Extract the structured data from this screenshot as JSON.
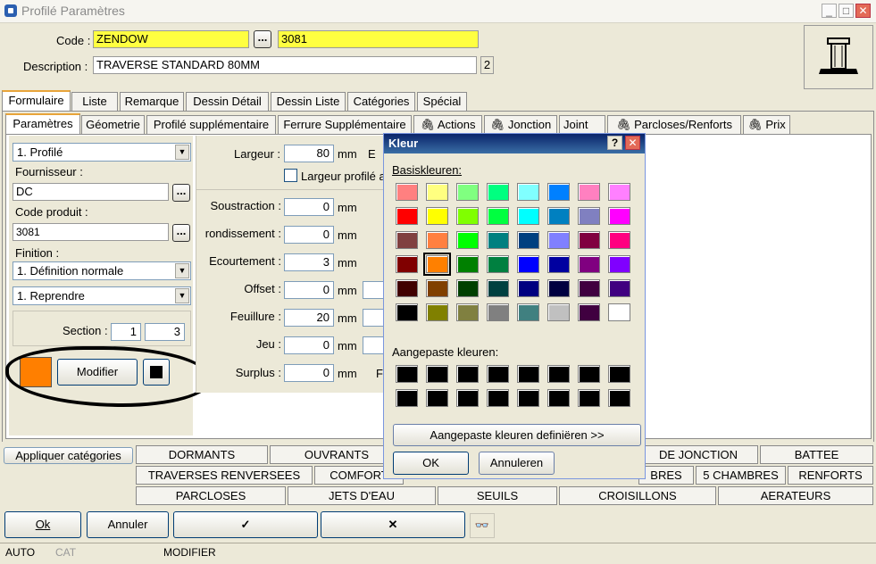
{
  "window": {
    "title": "Profilé Paramètres"
  },
  "header": {
    "code_label": "Code :",
    "code_value": "ZENDOW",
    "code_number": "3081",
    "desc_label": "Description :",
    "desc_value": "TRAVERSE STANDARD 80MM",
    "desc_badge": "2",
    "dots": "..."
  },
  "main_tabs": [
    "Formulaire",
    "Liste",
    "Remarque",
    "Dessin Détail",
    "Dessin Liste",
    "Catégories",
    "Spécial"
  ],
  "sub_tabs": [
    "Paramètres",
    "Géometrie",
    "Profilé supplémentaire",
    "Ferrure Supplémentaire",
    "Actions",
    "Jonction",
    "Joint",
    "Parcloses/Renforts",
    "Prix"
  ],
  "left": {
    "type_select": "1.  Profilé",
    "supplier_label": "Fournisseur :",
    "supplier_value": "DC",
    "product_label": "Code produit :",
    "product_value": "3081",
    "finish_label": "Finition :",
    "finish_select": "1.  Définition normale",
    "reprise_select": "1.  Reprendre",
    "section_label": "Section :",
    "section_a": "1",
    "section_b": "3",
    "modify_label": "Modifier",
    "color_swatch": "#ff7f00"
  },
  "params": {
    "width_label": "Largeur :",
    "width_value": "80",
    "width_unit": "mm",
    "width_extra": "E",
    "profile_width_label": "Largeur profilé a",
    "rows": [
      {
        "label": "Soustraction :",
        "value": "0",
        "unit": "mm"
      },
      {
        "label": "rondissement :",
        "value": "0",
        "unit": "mm"
      },
      {
        "label": "Ecourtement :",
        "value": "3",
        "unit": "mm"
      },
      {
        "label": "Offset :",
        "value": "0",
        "unit": "mm"
      },
      {
        "label": "Feuillure :",
        "value": "20",
        "unit": "mm"
      },
      {
        "label": "Jeu :",
        "value": "0",
        "unit": "mm"
      },
      {
        "label": "Surplus :",
        "value": "0",
        "unit": "mm",
        "extra": "F"
      }
    ]
  },
  "categories": {
    "apply_label": "Appliquer catégories",
    "row1": [
      "DORMANTS",
      "OUVRANTS",
      "DE JONCTION",
      "BATTEE"
    ],
    "row2": [
      "TRAVERSES RENVERSEES",
      "COMFORT",
      "BRES",
      "5 CHAMBRES",
      "RENFORTS"
    ],
    "row3": [
      "PARCLOSES",
      "JETS D'EAU",
      "SEUILS",
      "CROISILLONS",
      "AERATEURS"
    ]
  },
  "footer": {
    "ok": "Ok",
    "cancel": "Annuler",
    "check": "✓",
    "cross": "✕",
    "binoculars": "👓"
  },
  "status": {
    "auto": "AUTO",
    "cat": "CAT",
    "mode": "MODIFIER"
  },
  "dialog": {
    "title": "Kleur",
    "help": "?",
    "close": "✕",
    "basic_label": "Basiskleuren:",
    "custom_label": "Aangepaste kleuren:",
    "define_label": "Aangepaste kleuren definiëren >>",
    "ok": "OK",
    "cancel": "Annuleren",
    "basic_colors": [
      "#ff8080",
      "#ffff80",
      "#80ff80",
      "#00ff80",
      "#80ffff",
      "#0080ff",
      "#ff80c0",
      "#ff80ff",
      "#ff0000",
      "#ffff00",
      "#80ff00",
      "#00ff40",
      "#00ffff",
      "#0080c0",
      "#8080c0",
      "#ff00ff",
      "#804040",
      "#ff8040",
      "#00ff00",
      "#008080",
      "#004080",
      "#8080ff",
      "#800040",
      "#ff0080",
      "#800000",
      "#ff8000",
      "#008000",
      "#008040",
      "#0000ff",
      "#0000a0",
      "#800080",
      "#8000ff",
      "#400000",
      "#804000",
      "#004000",
      "#004040",
      "#000080",
      "#000040",
      "#400040",
      "#400080",
      "#000000",
      "#808000",
      "#808040",
      "#808080",
      "#408080",
      "#c0c0c0",
      "#400040",
      "#ffffff"
    ],
    "selected_index": 25,
    "custom_colors": [
      "#000000",
      "#000000",
      "#000000",
      "#000000",
      "#000000",
      "#000000",
      "#000000",
      "#000000",
      "#000000",
      "#000000",
      "#000000",
      "#000000",
      "#000000",
      "#000000",
      "#000000",
      "#000000"
    ]
  }
}
